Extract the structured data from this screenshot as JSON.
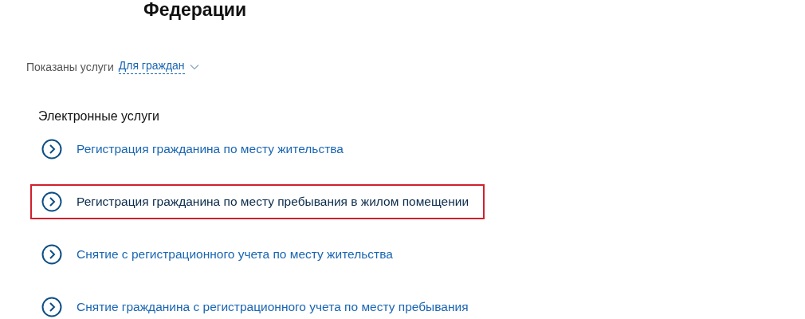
{
  "heading": "Федерации",
  "filter": {
    "label": "Показаны услуги",
    "value": "Для граждан"
  },
  "section_title": "Электронные услуги",
  "services": [
    {
      "label": "Регистрация гражданина по месту жительства",
      "highlighted": false
    },
    {
      "label": "Регистрация гражданина по месту пребывания в жилом помещении",
      "highlighted": true
    },
    {
      "label": "Снятие с регистрационного учета по месту жительства",
      "highlighted": false
    },
    {
      "label": "Снятие гражданина с регистрационного учета по месту пребывания",
      "highlighted": false
    }
  ]
}
